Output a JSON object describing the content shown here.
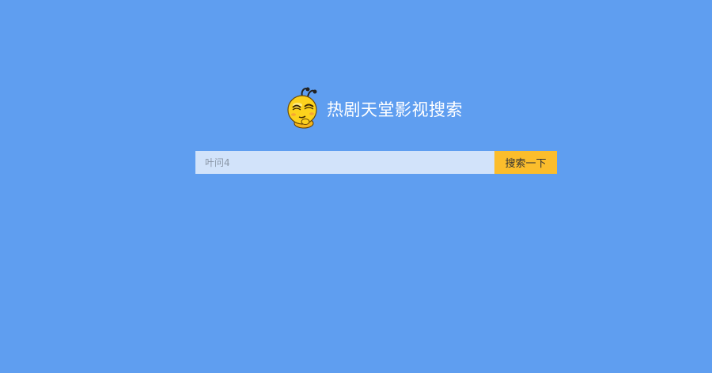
{
  "brand": {
    "title": "热剧天堂影视搜索",
    "logo_icon": "bee-mascot-icon"
  },
  "search": {
    "placeholder": "叶问4",
    "value": "",
    "button_label": "搜索一下"
  },
  "colors": {
    "background": "#5f9ef0",
    "input_background": "#d2e3fa",
    "button_background": "#fbbd2c",
    "title_text": "#ffffff"
  }
}
